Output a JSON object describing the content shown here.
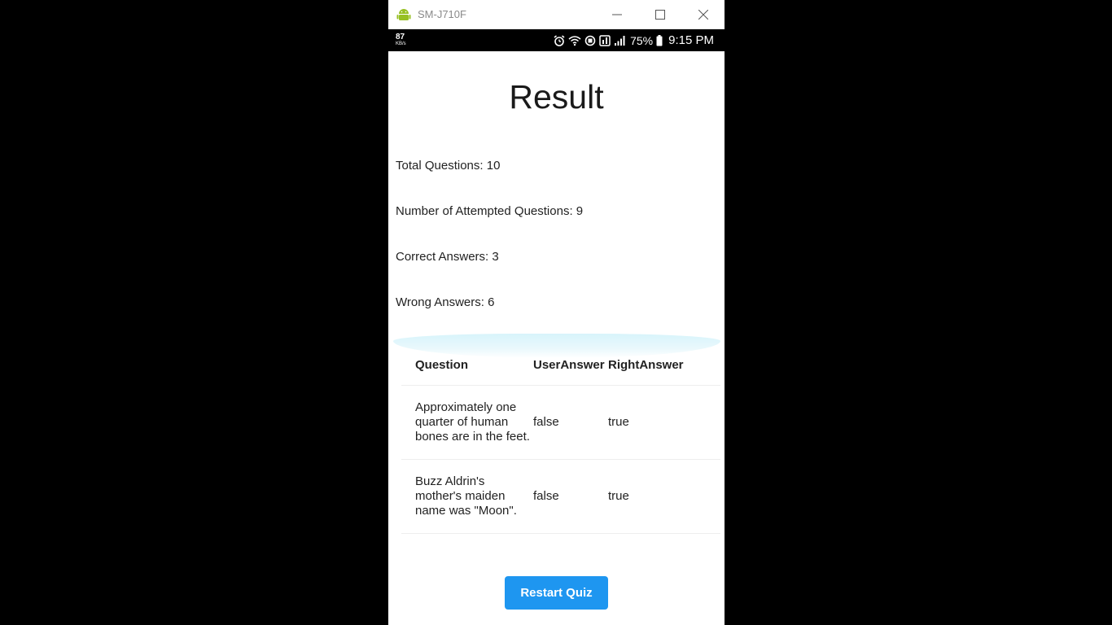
{
  "window": {
    "title": "SM-J710F"
  },
  "statusbar": {
    "net_speed": "87",
    "net_unit": "KB/s",
    "battery": "75%",
    "time": "9:15 PM"
  },
  "result": {
    "title": "Result",
    "total_questions": "Total Questions: 10",
    "attempted": "Number of Attempted Questions: 9",
    "correct": "Correct Answers: 3",
    "wrong": "Wrong Answers: 6"
  },
  "table": {
    "headers": {
      "question": "Question",
      "user_answer": "UserAnswer",
      "right_answer": "RightAnswer"
    },
    "rows": [
      {
        "question": "Approximately one quarter of human bones are in the feet.",
        "user_answer": "false",
        "right_answer": "true"
      },
      {
        "question": "Buzz Aldrin's mother's maiden name was \"Moon\".",
        "user_answer": "false",
        "right_answer": "true"
      }
    ]
  },
  "restart_button": "Restart Quiz",
  "colors": {
    "accent": "#1e96f0",
    "window_bg": "#ffffff",
    "status_bg": "#000000"
  },
  "icons": [
    "android-icon",
    "minimize-icon",
    "maximize-icon",
    "close-icon",
    "alarm-icon",
    "wifi-icon",
    "data-saver-icon",
    "nfc-icon",
    "signal-icon",
    "battery-icon"
  ]
}
